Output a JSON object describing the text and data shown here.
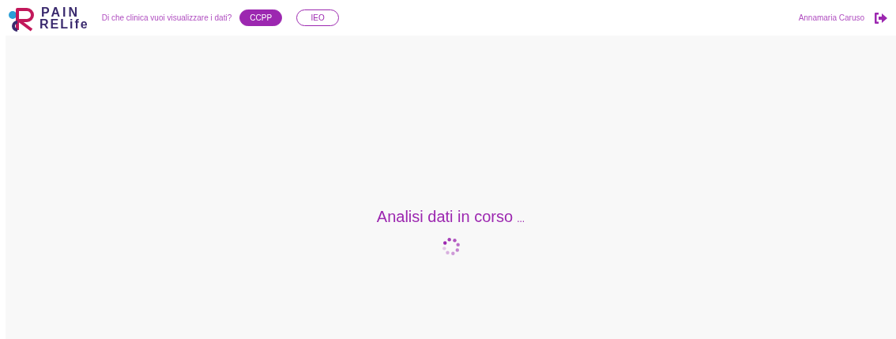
{
  "header": {
    "logo": {
      "line_1": "PAIN",
      "line_2": "RELife"
    },
    "clinic_prompt": "Di che clinica vuoi visualizzare i dati?",
    "clinics": [
      {
        "label": "CCPP",
        "selected": true
      },
      {
        "label": "IEO",
        "selected": false
      }
    ],
    "user_name": "Annamaria Caruso"
  },
  "main": {
    "status": "Analisi dati in corso",
    "status_suffix": "..."
  }
}
